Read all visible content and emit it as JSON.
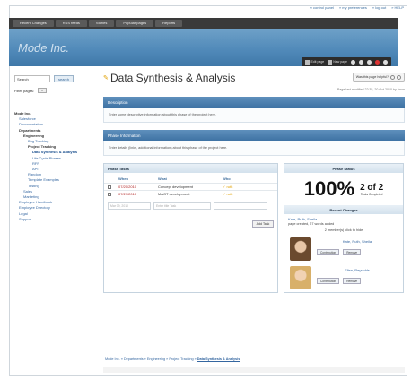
{
  "toplinks": [
    "« control panel",
    "» my preferences",
    "» log out",
    "» HELP"
  ],
  "navbar": [
    "Recent Changes",
    "RSS feeds",
    "Stories",
    "Popular pages",
    "Reports"
  ],
  "brand": "Mode Inc.",
  "toolbar": {
    "edit_page": "Edit page",
    "new_page": "New page"
  },
  "sidebar": {
    "search_placeholder": "Search",
    "search_button": "search",
    "filter_label": "Filter pages:",
    "filter_value": "▾",
    "tree": [
      {
        "label": "Mode Inc.",
        "indent": 0,
        "style": "bold"
      },
      {
        "label": "Salesforce",
        "indent": 1,
        "style": "link"
      },
      {
        "label": "Documentation",
        "indent": 1,
        "style": "link"
      },
      {
        "label": "Departments",
        "indent": 1,
        "style": "bold"
      },
      {
        "label": "Engineering",
        "indent": 2,
        "style": "bold"
      },
      {
        "label": "Bug Tracking",
        "indent": 3,
        "style": "link"
      },
      {
        "label": "Project Tracking",
        "indent": 3,
        "style": "bold"
      },
      {
        "label": "Data Synthesis & Analysis",
        "indent": 4,
        "style": "cur"
      },
      {
        "label": "Life Cycle Phases",
        "indent": 4,
        "style": "link"
      },
      {
        "label": "RFP",
        "indent": 4,
        "style": "link"
      },
      {
        "label": "API",
        "indent": 4,
        "style": "link"
      },
      {
        "label": "Random",
        "indent": 3,
        "style": "link"
      },
      {
        "label": "Template Examples",
        "indent": 3,
        "style": "link"
      },
      {
        "label": "Testing",
        "indent": 3,
        "style": "link"
      },
      {
        "label": "Sales",
        "indent": 2,
        "style": "link"
      },
      {
        "label": "Marketing",
        "indent": 2,
        "style": "link"
      },
      {
        "label": "Employee Handbook",
        "indent": 1,
        "style": "link"
      },
      {
        "label": "Employee Directory",
        "indent": 1,
        "style": "link"
      },
      {
        "label": "Legal",
        "indent": 1,
        "style": "link"
      },
      {
        "label": "Support",
        "indent": 1,
        "style": "link"
      }
    ]
  },
  "main": {
    "title": "Data Synthesis & Analysis",
    "helpful": "Was this page helpful?",
    "modified": "Page last modified 22:35, 20 Oct 2010 by Anon",
    "description_head": "Description",
    "description_body": "Enter some descriptive information about this phase of the project here.",
    "phase_head": "Phase Information",
    "phase_body": "Enter details (links, additional information) about this phase of the project here."
  },
  "tasks": {
    "title": "Phase Tasks",
    "columns": [
      "When",
      "What",
      "Who"
    ],
    "rows": [
      {
        "when": "07/20/2010",
        "what": "Concept development",
        "who": "✓ ruth"
      },
      {
        "when": "07/29/2010",
        "what": "MAGT development",
        "who": "✓ ruth"
      }
    ],
    "new_date": "Mar 09, 2010",
    "new_task": "Enter title Task",
    "add_label": "Add Task"
  },
  "status": {
    "title": "Phase Status",
    "percent": "100%",
    "fraction": "2 of 2",
    "caption": "Tasks Completed",
    "recent_head": "Recent Changes",
    "recent_name": "Kate, Ruth, Sheila",
    "recent_msg": "page created, 27 words added",
    "members_text": "2 member(s) click to hide",
    "members": [
      {
        "name": "Kate, Ruth, Sheila",
        "b1": "Contribution",
        "b2": "Remove"
      },
      {
        "name": "Ellen, Reynolds",
        "b1": "Contribution",
        "b2": "Remove"
      }
    ]
  },
  "breadcrumb": {
    "path": "Mode Inc. » Departments » Engineering » Project Tracking » ",
    "current": "Data Synthesis & Analysis"
  }
}
